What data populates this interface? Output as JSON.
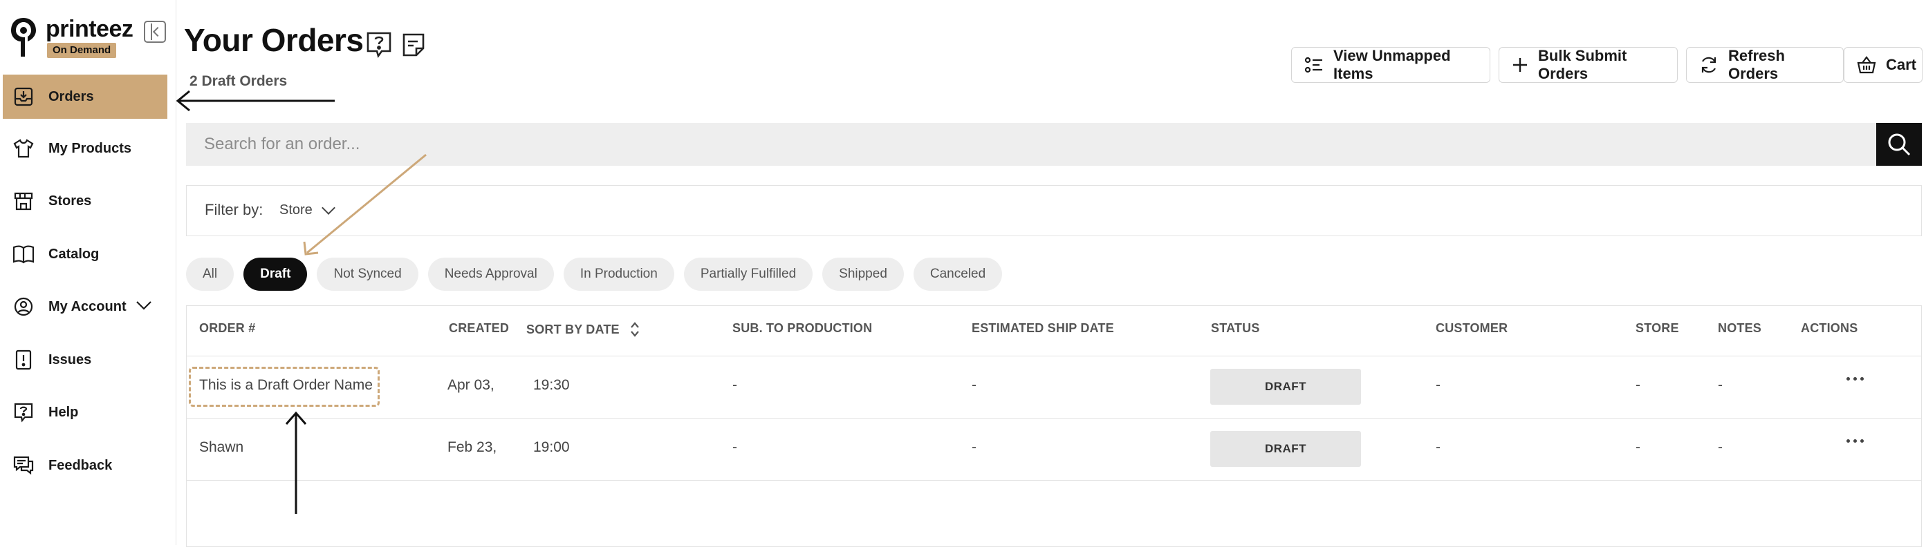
{
  "brand": {
    "name": "printeez",
    "badge": "On Demand"
  },
  "sidebar": {
    "items": [
      {
        "label": "Orders",
        "icon": "inbox-download-icon",
        "active": true
      },
      {
        "label": "My Products",
        "icon": "tshirt-icon"
      },
      {
        "label": "Stores",
        "icon": "store-icon"
      },
      {
        "label": "Catalog",
        "icon": "book-icon"
      },
      {
        "label": "My Account",
        "icon": "user-circle-icon",
        "expandable": true
      },
      {
        "label": "Issues",
        "icon": "alert-document-icon"
      },
      {
        "label": "Help",
        "icon": "help-bubble-icon"
      },
      {
        "label": "Feedback",
        "icon": "feedback-icon"
      }
    ]
  },
  "header": {
    "title": "Your Orders",
    "draft_count": "2 Draft Orders",
    "buttons": {
      "unmapped": "View Unmapped Items",
      "bulk": "Bulk Submit Orders",
      "refresh": "Refresh Orders",
      "cart": "Cart"
    }
  },
  "search": {
    "placeholder": "Search for an order..."
  },
  "filter": {
    "label": "Filter by:",
    "store": "Store"
  },
  "tabs": [
    "All",
    "Draft",
    "Not Synced",
    "Needs Approval",
    "In Production",
    "Partially Fulfilled",
    "Shipped",
    "Canceled"
  ],
  "active_tab": "Draft",
  "table": {
    "headers": {
      "order": "ORDER #",
      "created": "CREATED",
      "sort": "SORT BY DATE",
      "sub": "SUB. TO PRODUCTION",
      "ship": "ESTIMATED SHIP DATE",
      "status": "STATUS",
      "customer": "CUSTOMER",
      "store": "STORE",
      "notes": "NOTES",
      "actions": "ACTIONS"
    },
    "rows": [
      {
        "order": "This is a Draft Order Name",
        "date": "Apr 03,",
        "time": "19:30",
        "sub": "-",
        "ship": "-",
        "status": "DRAFT",
        "customer": "-",
        "store": "-",
        "notes": "-"
      },
      {
        "order": "Shawn",
        "date": "Feb 23,",
        "time": "19:00",
        "sub": "-",
        "ship": "-",
        "status": "DRAFT",
        "customer": "-",
        "store": "-",
        "notes": "-"
      }
    ]
  },
  "colors": {
    "accent": "#cda879",
    "dark": "#111111",
    "muted": "#eeeeee"
  }
}
